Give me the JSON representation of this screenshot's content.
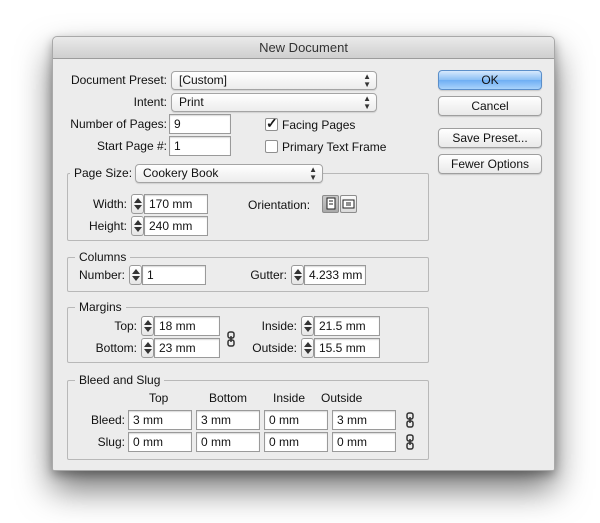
{
  "window": {
    "title": "New Document"
  },
  "document": {
    "preset_label": "Document Preset:",
    "preset_value": "[Custom]",
    "intent_label": "Intent:",
    "intent_value": "Print",
    "pages_label": "Number of Pages:",
    "pages_value": "9",
    "start_label": "Start Page #:",
    "start_value": "1",
    "facing_pages_label": "Facing Pages",
    "facing_pages_checked": true,
    "primary_frame_label": "Primary Text Frame",
    "primary_frame_checked": false
  },
  "buttons": {
    "ok": "OK",
    "cancel": "Cancel",
    "save_preset": "Save Preset...",
    "fewer_options": "Fewer Options"
  },
  "page_size": {
    "label": "Page Size:",
    "value": "Cookery Book",
    "width_label": "Width:",
    "width_value": "170 mm",
    "height_label": "Height:",
    "height_value": "240 mm",
    "orientation_label": "Orientation:",
    "orientation_selected": "portrait"
  },
  "columns": {
    "title": "Columns",
    "number_label": "Number:",
    "number_value": "1",
    "gutter_label": "Gutter:",
    "gutter_value": "4.233 mm"
  },
  "margins": {
    "title": "Margins",
    "top_label": "Top:",
    "top_value": "18 mm",
    "bottom_label": "Bottom:",
    "bottom_value": "23 mm",
    "inside_label": "Inside:",
    "inside_value": "21.5 mm",
    "outside_label": "Outside:",
    "outside_value": "15.5 mm"
  },
  "bleed_slug": {
    "title": "Bleed and Slug",
    "headers": [
      "Top",
      "Bottom",
      "Inside",
      "Outside"
    ],
    "bleed_label": "Bleed:",
    "bleed_values": [
      "3 mm",
      "3 mm",
      "0 mm",
      "3 mm"
    ],
    "slug_label": "Slug:",
    "slug_values": [
      "0 mm",
      "0 mm",
      "0 mm",
      "0 mm"
    ]
  },
  "colors": {
    "window_bg": "#ececec",
    "primary_button": "#8cc0f5"
  }
}
